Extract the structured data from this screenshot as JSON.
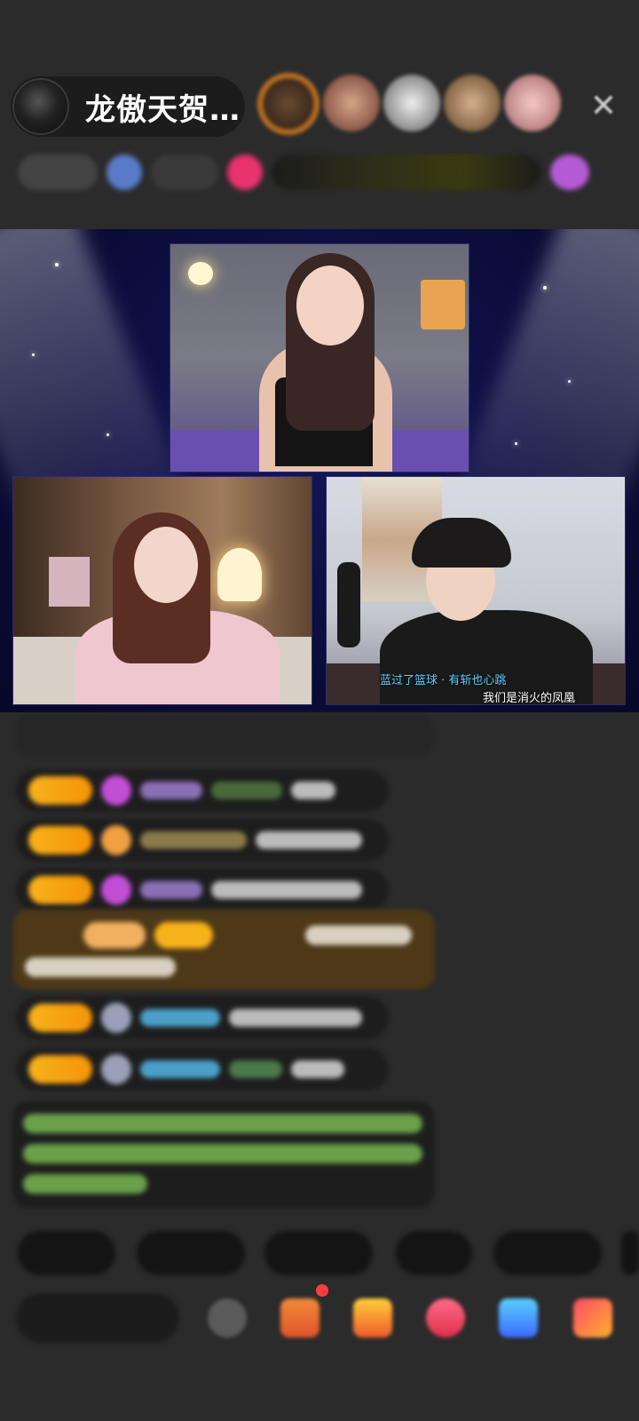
{
  "header": {
    "host_name": "龙傲天贺…",
    "close_glyph": "✕"
  },
  "video": {
    "caption_right_top": "蓝过了篮球 · 有斩也心跳",
    "caption_right_bottom": "我们是消火的凤凰"
  },
  "colors": {
    "background": "#2b2b2c",
    "stage": "#0b0d3c",
    "badge": "#f7b21a",
    "gift_banner": "#4d3817"
  },
  "icons": [
    "close-icon",
    "emoji-icon",
    "gift-box-icon",
    "treasure-icon",
    "heart-icon",
    "game-icon",
    "more-icon"
  ]
}
